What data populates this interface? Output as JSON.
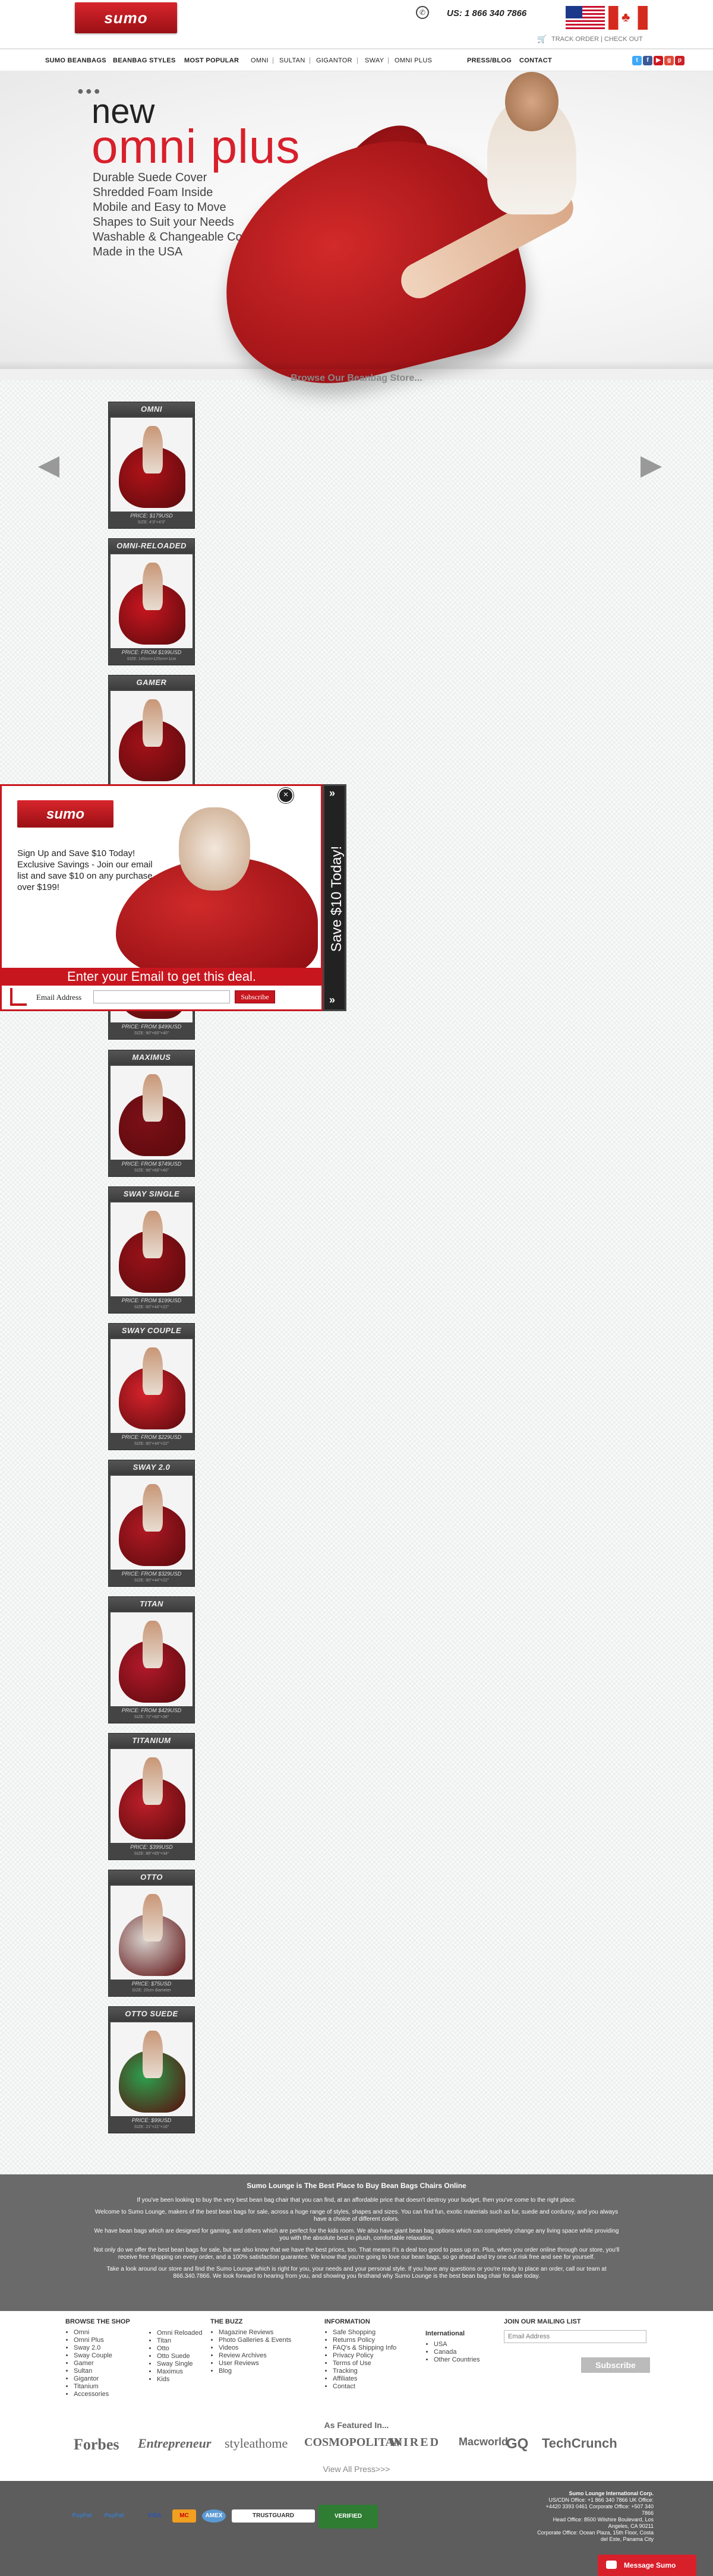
{
  "header": {
    "logo": "sumo",
    "phone": "US: 1 866 340 7866",
    "track_order": "TRACK ORDER | CHECK OUT"
  },
  "nav": {
    "items": [
      "SUMO BEANBAGS",
      "BEANBAG STYLES",
      "MOST POPULAR"
    ],
    "sub_items": [
      "OMNI",
      "SULTAN",
      "GIGANTOR",
      "SWAY",
      "OMNI PLUS"
    ],
    "right_items": [
      "PRESS/BLOG",
      "CONTACT"
    ]
  },
  "hero": {
    "dots": "●●●",
    "line1": "new",
    "line2": "omni plus",
    "features": [
      "Durable Suede Cover",
      "Shredded Foam Inside",
      "Mobile and Easy to Move",
      "Shapes to Suit your Needs",
      "Washable & Changeable Covers",
      "Made in the USA"
    ]
  },
  "browse_title": "Browse Our Beanbag Store...",
  "products": [
    {
      "name": "OMNI",
      "price": "PRICE: $179USD",
      "size": "SIZE: 4'3\"×4'3\""
    },
    {
      "name": "OMNI-RELOADED",
      "price": "PRICE: FROM $199USD",
      "size": "SIZE: 145cm×125cm×1cm"
    },
    {
      "name": "GAMER",
      "price": "",
      "size": ""
    },
    {
      "name": "",
      "price": "PRICE: FROM $499USD",
      "size": "SIZE: 90\"×60\"×40\""
    },
    {
      "name": "MAXIMUS",
      "price": "PRICE: FROM $749USD",
      "size": "SIZE: 96\"×66\"×40\""
    },
    {
      "name": "SWAY SINGLE",
      "price": "PRICE: FROM $199USD",
      "size": "SIZE: 60\"×44\"×22\""
    },
    {
      "name": "SWAY COUPLE",
      "price": "PRICE: FROM $229USD",
      "size": "SIZE: 80\"×44\"×22\""
    },
    {
      "name": "SWAY 2.0",
      "price": "PRICE: FROM $329USD",
      "size": "SIZE: 90\"×44\"×22\""
    },
    {
      "name": "TITAN",
      "price": "PRICE: FROM $429USD",
      "size": "SIZE: 72\"×60\"×36\""
    },
    {
      "name": "TITANIUM",
      "price": "PRICE: $399USD",
      "size": "SIZE: 86\"×65\"×34\""
    },
    {
      "name": "OTTO",
      "price": "PRICE: $75USD",
      "size": "SIZE: 20cm diameter"
    },
    {
      "name": "OTTO SUEDE",
      "price": "PRICE: $99USD",
      "size": "SIZE: 21\"×21\"×16\""
    }
  ],
  "popup": {
    "logo": "sumo",
    "text": "Sign Up and Save $10 Today! Exclusive Savings - Join our email list and save $10 on any purchase over $199!",
    "bar": "Enter your Email to get this deal.",
    "email_label": "Email Address",
    "subscribe": "Subscribe",
    "tab": "Save $10 Today!",
    "close": "×"
  },
  "about": {
    "title": "Sumo Lounge is The Best Place to Buy Bean Bags Chairs Online",
    "paragraphs": [
      "If you've been looking to buy the very best bean bag chair that you can find, at an affordable price that doesn't destroy your budget, then you've come to the right place.",
      "Welcome to Sumo Lounge, makers of the best bean bags for sale, across a huge range of styles, shapes and sizes. You can find fun, exotic materials such as fur, suede and corduroy, and you always have a choice of different colors.",
      "We have bean bags which are designed for gaming, and others which are perfect for the kids room. We also have giant bean bag options which can completely change any living space while providing you with the absolute best in plush, comfortable relaxation.",
      "Not only do we offer the best bean bags for sale, but we also know that we have the best prices, too. That means it's a deal too good to pass up on. Plus, when you order online through our store, you'll receive free shipping on every order, and a 100% satisfaction guarantee. We know that you're going to love our bean bags, so go ahead and try one out risk free and see for yourself.",
      "Take a look around our store and find the Sumo Lounge which is right for you, your needs and your personal style. If you have any questions or you're ready to place an order, call our team at 866.340.7866. We look forward to hearing from you, and showing you firsthand why Sumo Lounge is the best bean bag chair for sale today."
    ]
  },
  "footer": {
    "browse_title": "BROWSE THE SHOP",
    "browse_col1": [
      "Omni",
      "Omni Plus",
      "Sway 2.0",
      "Sway Couple",
      "Gamer",
      "Sultan",
      "Gigantor",
      "Titanium",
      "Accessories"
    ],
    "browse_col2": [
      "Omni Reloaded",
      "Titan",
      "Otto",
      "Otto Suede",
      "Sway Single",
      "Maximus",
      "Kids"
    ],
    "buzz_title": "THE BUZZ",
    "buzz": [
      "Magazine Reviews",
      "Photo Galleries & Events",
      "Videos",
      "Review Archives",
      "User Reviews",
      "Blog"
    ],
    "info_title": "INFORMATION",
    "info": [
      "Safe Shopping",
      "Returns Policy",
      "FAQ's & Shipping Info",
      "Privacy Policy",
      "Terms of Use",
      "Tracking",
      "Affiliates",
      "Contact"
    ],
    "intl_title": "International",
    "intl": [
      "USA",
      "Canada",
      "Other Countries"
    ],
    "mail_title": "JOIN OUR MAILING LIST",
    "mail_placeholder": "Email Address",
    "mail_button": "Subscribe",
    "featured_title": "As Featured In...",
    "press": [
      "Forbes",
      "Entrepreneur",
      "styleathome",
      "COSMOPOLITAN",
      "WIRED",
      "Macworld",
      "GQ",
      "TechCrunch"
    ],
    "view_press": "View All Press>>>"
  },
  "bottom": {
    "payments": [
      "PayPal",
      "PayPal",
      "VISA",
      "MC",
      "AMEX",
      "TRUSTGUARD",
      "VERIFIED"
    ],
    "contact_lines": [
      "Sumo Lounge International Corp.",
      "US/CDN Office: +1 866 340 7866 UK Office: +4420 3393 0461 Corporate Office: +507 340 7866",
      "Head Office: 8500 Wilshire Boulevard, Los Angeles, CA 90211",
      "Corporate Office: Ocean Plaza, 15th Floor, Costa del Este, Panama City"
    ],
    "message": "Message Sumo"
  },
  "colors": {
    "brand_red": "#d8202b",
    "dark": "#444444"
  }
}
